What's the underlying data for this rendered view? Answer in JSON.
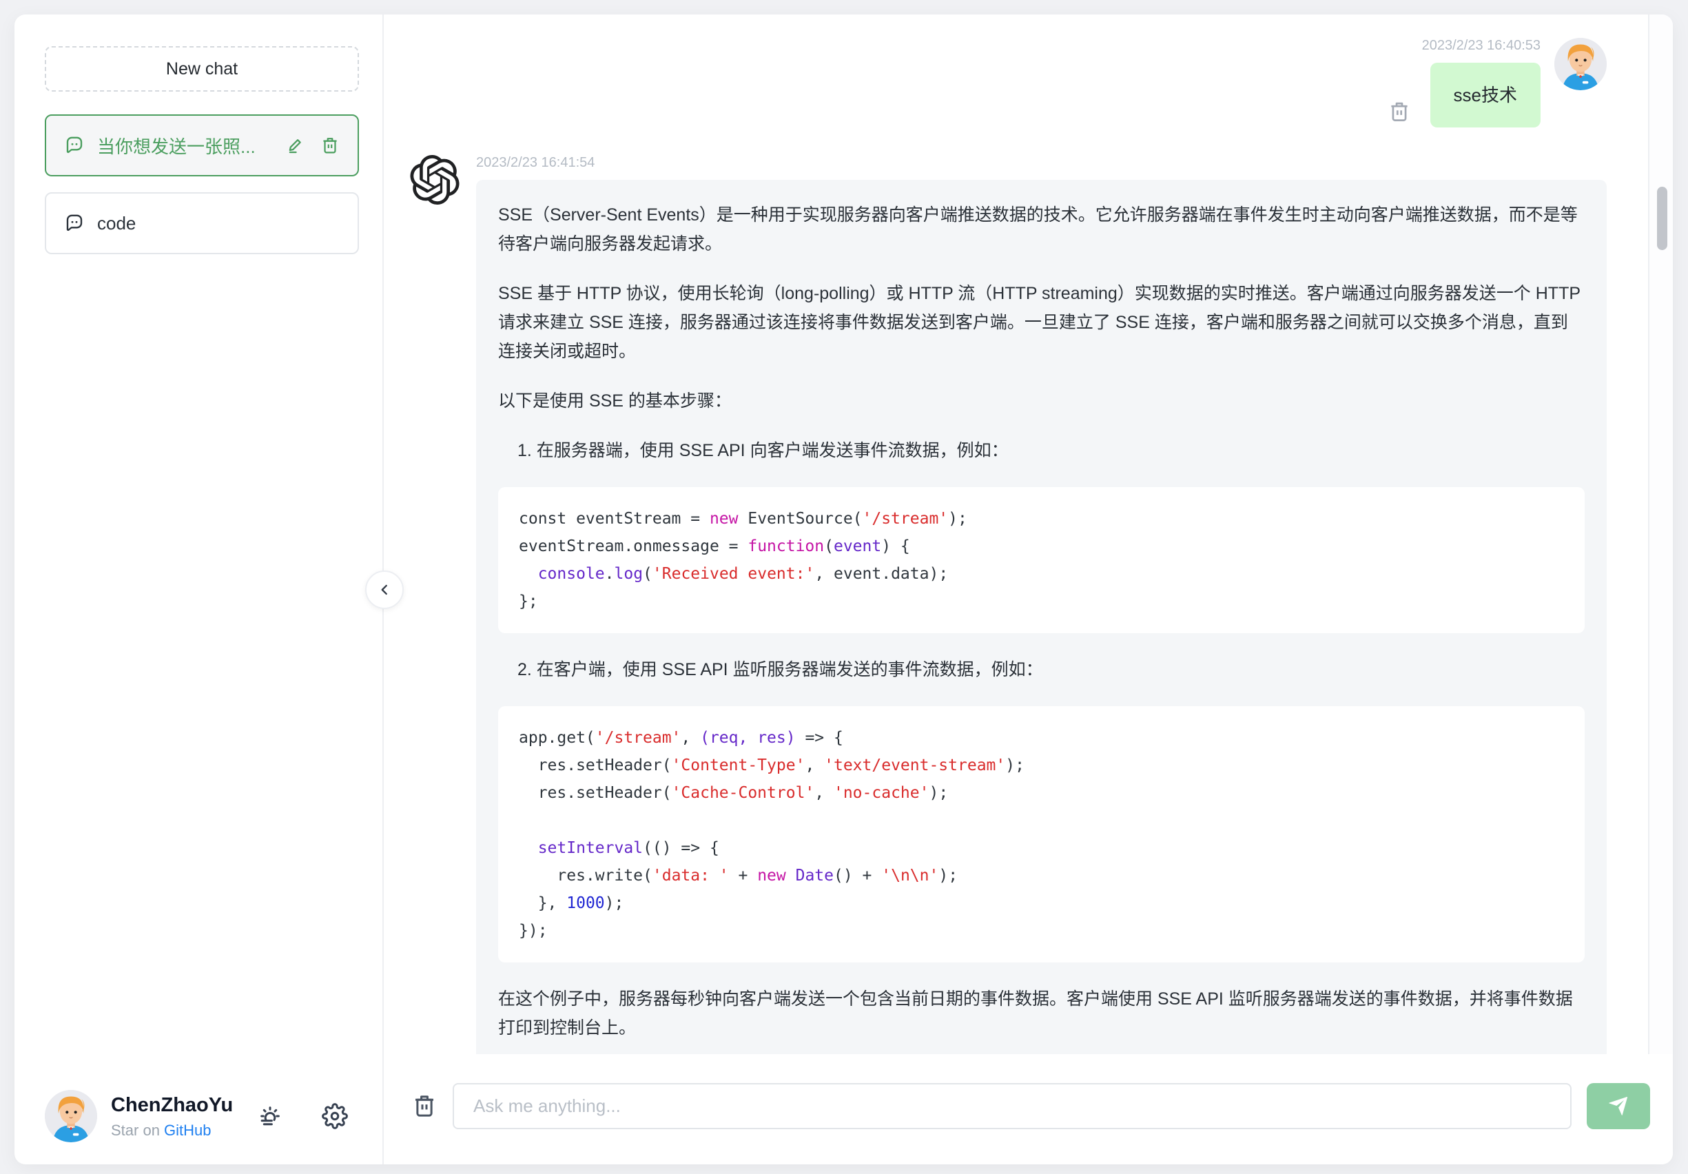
{
  "sidebar": {
    "new_chat_label": "New chat",
    "items": [
      {
        "title": "当你想发送一张照...",
        "active": true
      },
      {
        "title": "code",
        "active": false
      }
    ],
    "user": {
      "name": "ChenZhaoYu",
      "star_prefix": "Star on ",
      "star_link": "GitHub"
    }
  },
  "chat": {
    "user_message": {
      "timestamp": "2023/2/23 16:40:53",
      "text": "sse技术"
    },
    "assistant": {
      "timestamp": "2023/2/23 16:41:54",
      "blocks": [
        {
          "type": "p",
          "text": "SSE（Server-Sent Events）是一种用于实现服务器向客户端推送数据的技术。它允许服务器端在事件发生时主动向客户端推送数据，而不是等待客户端向服务器发起请求。"
        },
        {
          "type": "p",
          "text": "SSE 基于 HTTP 协议，使用长轮询（long-polling）或 HTTP 流（HTTP streaming）实现数据的实时推送。客户端通过向服务器发送一个 HTTP 请求来建立 SSE 连接，服务器通过该连接将事件数据发送到客户端。一旦建立了 SSE 连接，客户端和服务器之间就可以交换多个消息，直到连接关闭或超时。"
        },
        {
          "type": "p",
          "text": "以下是使用 SSE 的基本步骤："
        },
        {
          "type": "li",
          "text": "1. 在服务器端，使用 SSE API 向客户端发送事件流数据，例如："
        },
        {
          "type": "code",
          "lines": [
            [
              {
                "c": "plain",
                "t": "const eventStream = "
              },
              {
                "c": "kw",
                "t": "new"
              },
              {
                "c": "plain",
                "t": " EventSource("
              },
              {
                "c": "str",
                "t": "'/stream'"
              },
              {
                "c": "plain",
                "t": ");"
              }
            ],
            [
              {
                "c": "plain",
                "t": "eventStream.onmessage = "
              },
              {
                "c": "kw",
                "t": "function"
              },
              {
                "c": "plain",
                "t": "("
              },
              {
                "c": "id",
                "t": "event"
              },
              {
                "c": "plain",
                "t": ") {"
              }
            ],
            [
              {
                "c": "plain",
                "t": "  "
              },
              {
                "c": "id",
                "t": "console"
              },
              {
                "c": "plain",
                "t": "."
              },
              {
                "c": "id",
                "t": "log"
              },
              {
                "c": "plain",
                "t": "("
              },
              {
                "c": "str",
                "t": "'Received event:'"
              },
              {
                "c": "plain",
                "t": ", event.data);"
              }
            ],
            [
              {
                "c": "plain",
                "t": "};"
              }
            ]
          ]
        },
        {
          "type": "li",
          "text": "2. 在客户端，使用 SSE API 监听服务器端发送的事件流数据，例如："
        },
        {
          "type": "code",
          "lines": [
            [
              {
                "c": "plain",
                "t": "app.get("
              },
              {
                "c": "str",
                "t": "'/stream'"
              },
              {
                "c": "plain",
                "t": ", "
              },
              {
                "c": "id",
                "t": "(req, res)"
              },
              {
                "c": "plain",
                "t": " => {"
              }
            ],
            [
              {
                "c": "plain",
                "t": "  res.setHeader("
              },
              {
                "c": "str",
                "t": "'Content-Type'"
              },
              {
                "c": "plain",
                "t": ", "
              },
              {
                "c": "str",
                "t": "'text/event-stream'"
              },
              {
                "c": "plain",
                "t": ");"
              }
            ],
            [
              {
                "c": "plain",
                "t": "  res.setHeader("
              },
              {
                "c": "str",
                "t": "'Cache-Control'"
              },
              {
                "c": "plain",
                "t": ", "
              },
              {
                "c": "str",
                "t": "'no-cache'"
              },
              {
                "c": "plain",
                "t": ");"
              }
            ],
            [],
            [
              {
                "c": "plain",
                "t": "  "
              },
              {
                "c": "id",
                "t": "setInterval"
              },
              {
                "c": "plain",
                "t": "(() => {"
              }
            ],
            [
              {
                "c": "plain",
                "t": "    res.write("
              },
              {
                "c": "str",
                "t": "'data: '"
              },
              {
                "c": "plain",
                "t": " + "
              },
              {
                "c": "kw",
                "t": "new"
              },
              {
                "c": "plain",
                "t": " "
              },
              {
                "c": "id",
                "t": "Date"
              },
              {
                "c": "plain",
                "t": "() + "
              },
              {
                "c": "str",
                "t": "'\\n\\n'"
              },
              {
                "c": "plain",
                "t": ");"
              }
            ],
            [
              {
                "c": "plain",
                "t": "  }, "
              },
              {
                "c": "num",
                "t": "1000"
              },
              {
                "c": "plain",
                "t": ");"
              }
            ],
            [
              {
                "c": "plain",
                "t": "});"
              }
            ]
          ]
        },
        {
          "type": "p",
          "text": "在这个例子中，服务器每秒钟向客户端发送一个包含当前日期的事件数据。客户端使用 SSE API 监听服务器端发送的事件数据，并将事件数据打印到控制台上。"
        }
      ]
    }
  },
  "footer": {
    "input_placeholder": "Ask me anything...",
    "input_value": ""
  },
  "colors": {
    "accent_green": "#4b9e5f",
    "user_bubble_green": "#d2f9d1",
    "assistant_bubble_gray": "#f4f6f8",
    "send_button_green": "#8ecfa4",
    "link_blue": "#2080f0",
    "timestamp_gray": "#b4bbc4",
    "code_keyword": "#c515a5",
    "code_identifier": "#6528c9",
    "code_string": "#d92c2c",
    "code_number": "#2026d3"
  }
}
